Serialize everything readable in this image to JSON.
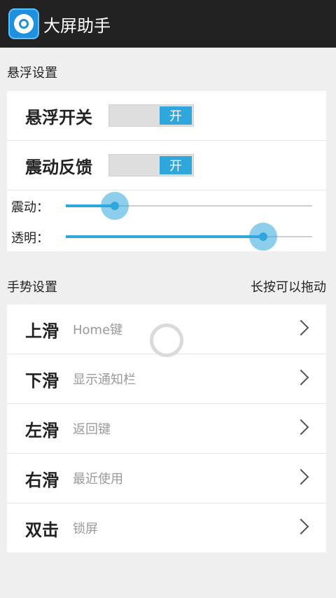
{
  "app": {
    "title": "大屏助手"
  },
  "float_section": {
    "label": "悬浮设置",
    "float_switch": {
      "label": "悬浮开关",
      "state": "开"
    },
    "vibration_feedback": {
      "label": "震动反馈",
      "state": "开"
    },
    "vibration_slider": {
      "label": "震动：",
      "value_fraction": 0.2
    },
    "transparency_slider": {
      "label": "透明：",
      "value_fraction": 0.8
    }
  },
  "gesture_section": {
    "label": "手势设置",
    "hint": "长按可以拖动",
    "items": [
      {
        "gesture": "上滑",
        "action": "Home键"
      },
      {
        "gesture": "下滑",
        "action": "显示通知栏"
      },
      {
        "gesture": "左滑",
        "action": "返回键"
      },
      {
        "gesture": "右滑",
        "action": "最近使用"
      },
      {
        "gesture": "双击",
        "action": "锁屏"
      }
    ]
  },
  "colors": {
    "accent": "#2fa6dc",
    "actionbar": "#222222"
  }
}
